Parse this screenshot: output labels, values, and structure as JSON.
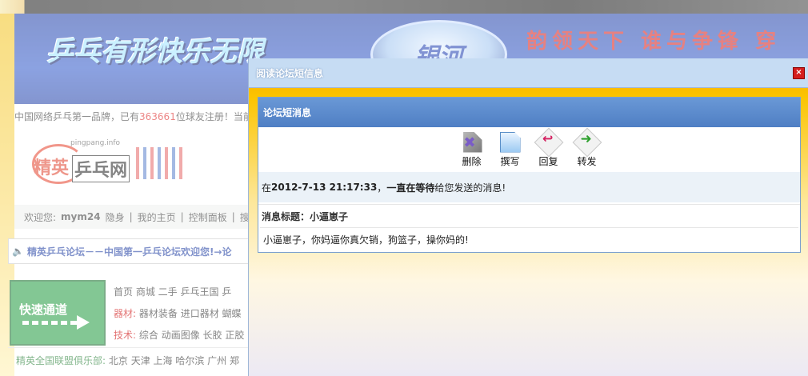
{
  "page": {
    "banner": {
      "slogan": "乒乓有形快乐无限",
      "logo_text": "银河",
      "right_text": "韵领天下 谁与争锋 穿"
    },
    "stats": {
      "prefix": "中国网络乒乓第一品牌，已有",
      "count": "363661",
      "suffix": "位球友注册！当前"
    },
    "site_logo": {
      "url": "pingpang.info",
      "word1": "精英",
      "word2": "乒乓网"
    },
    "userbar": {
      "welcome": "欢迎您:",
      "username": "mym24",
      "items": [
        "隐身",
        "我的主页",
        "控制面板",
        "搜"
      ]
    },
    "marquee": "精英乒乓论坛－－中国第一乒乓论坛欢迎您!→论",
    "quick_access": {
      "label": "快速通道"
    },
    "links": {
      "row1": "首页 商城 二手 乒乓王国 乒",
      "row2_label": "器材:",
      "row2": "器材装备 进口器材 蝴蝶",
      "row3_label": "技术:",
      "row3": "综合 动画图像 长胶 正胶"
    },
    "league": {
      "label": "精英全国联盟俱乐部:",
      "cities": "北京 天津 上海 哈尔滨 广州 郑"
    }
  },
  "dialog": {
    "title": "阅读论坛短信息",
    "close_icon": "close-icon",
    "panel_title": "论坛短消息",
    "toolbar": [
      {
        "label": "删除",
        "icon": "delete-icon"
      },
      {
        "label": "撰写",
        "icon": "compose-icon"
      },
      {
        "label": "回复",
        "icon": "reply-icon"
      },
      {
        "label": "转发",
        "icon": "forward-icon"
      }
    ],
    "notice": {
      "prefix": "在",
      "datetime": "2012-7-13 21:17:33",
      "mid": "，",
      "sender": "一直在等待",
      "suffix": "给您发送的消息!"
    },
    "subject": "消息标题：小逼崽子",
    "body": "小逼崽子，你妈逼你真欠销，狗篮子，操你妈的!"
  }
}
